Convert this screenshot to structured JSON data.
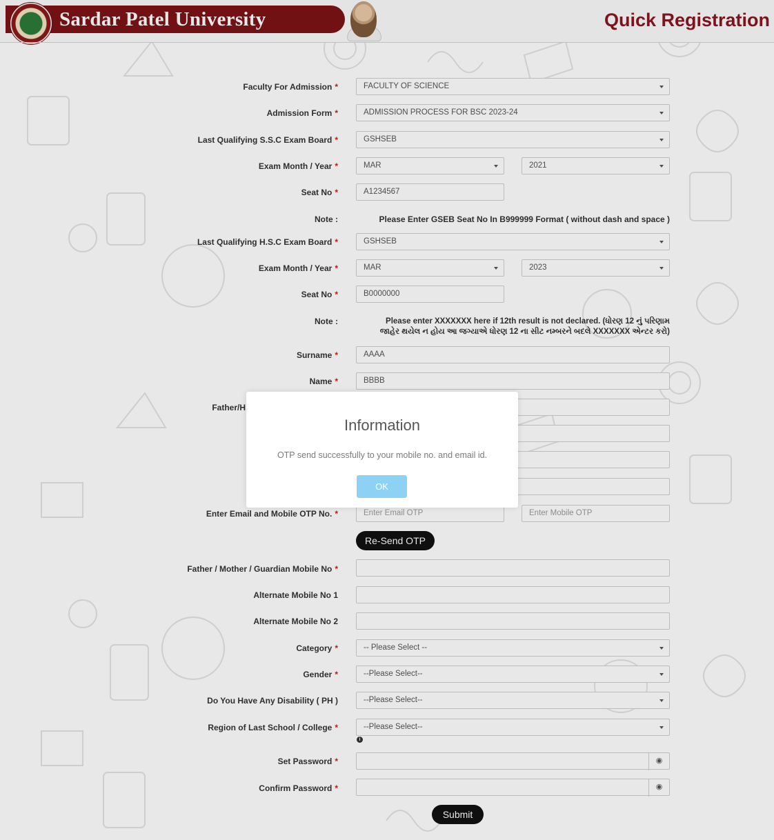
{
  "header": {
    "university_name": "Sardar Patel University",
    "page_title": "Quick Registration",
    "logo_text": "SARDAR PATEL UNIVERSITY"
  },
  "form": {
    "faculty": {
      "label": "Faculty For Admission",
      "value": "FACULTY OF SCIENCE"
    },
    "admission_form": {
      "label": "Admission Form",
      "value": "ADMISSION PROCESS FOR BSC 2023-24"
    },
    "ssc_board": {
      "label": "Last Qualifying S.S.C Exam Board",
      "value": "GSHSEB"
    },
    "ssc_exam": {
      "label": "Exam Month / Year",
      "month": "MAR",
      "year": "2021"
    },
    "ssc_seat": {
      "label": "Seat No",
      "value": "A1234567"
    },
    "ssc_note": {
      "label": "Note :",
      "text": "Please Enter GSEB Seat No In B999999 Format ( without dash and space )"
    },
    "hsc_board": {
      "label": "Last Qualifying H.S.C Exam Board",
      "value": "GSHSEB"
    },
    "hsc_exam": {
      "label": "Exam Month / Year",
      "month": "MAR",
      "year": "2023"
    },
    "hsc_seat": {
      "label": "Seat No",
      "value": "B0000000"
    },
    "hsc_note": {
      "label": "Note :",
      "line1": "Please enter XXXXXXX here if 12th result is not declared. (ધોરણ 12 નું પરિણામ",
      "line2": "જાહેર થયેલ ન હોય આ જગ્યાએ ધોરણ 12 ના સીટ નમ્બરને બદલે XXXXXXX એન્ટર કરો)"
    },
    "surname": {
      "label": "Surname",
      "value": "AAAA"
    },
    "name": {
      "label": "Name",
      "value": "BBBB"
    },
    "father_name": {
      "label": "Father/H"
    },
    "otp": {
      "label": "Enter Email and Mobile OTP No.",
      "email_placeholder": "Enter Email OTP",
      "mobile_placeholder": "Enter Mobile OTP",
      "resend_label": "Re-Send OTP"
    },
    "guardian_mobile": {
      "label": "Father / Mother / Guardian Mobile No"
    },
    "alt_mobile_1": {
      "label": "Alternate Mobile No 1"
    },
    "alt_mobile_2": {
      "label": "Alternate Mobile No 2"
    },
    "category": {
      "label": "Category",
      "value": "-- Please Select --"
    },
    "gender": {
      "label": "Gender",
      "value": "--Please Select--"
    },
    "disability": {
      "label": "Do You Have Any Disability ( PH )",
      "value": "--Please Select--"
    },
    "region": {
      "label": "Region of Last School / College",
      "value": "--Please Select--"
    },
    "set_password": {
      "label": "Set Password"
    },
    "confirm_password": {
      "label": "Confirm Password"
    },
    "submit_label": "Submit",
    "required_mark": "*"
  },
  "modal": {
    "title": "Information",
    "message": "OTP send successfully to your mobile no. and email id.",
    "ok_label": "OK"
  },
  "colors": {
    "brand": "#7d1317",
    "heading": "#8a1620",
    "required": "#d21b1b",
    "ok_button": "#8dd1f5"
  }
}
